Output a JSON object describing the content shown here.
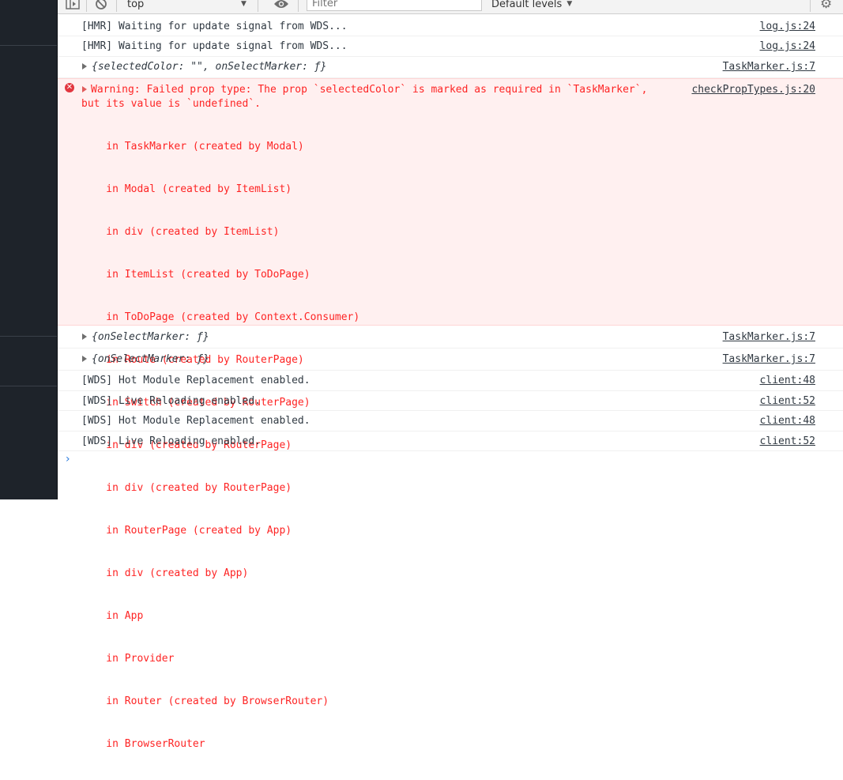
{
  "toolbar": {
    "context": "top",
    "filter_placeholder": "Filter",
    "levels": "Default levels"
  },
  "logs_top": [
    {
      "msg": "[HMR] Waiting for update signal from WDS...",
      "src": "log.js:24"
    },
    {
      "msg": "[HMR] Waiting for update signal from WDS...",
      "src": "log.js:24"
    },
    {
      "msg": "{selectedColor: \"\", onSelectMarker: ƒ}",
      "src": "TaskMarker.js:7"
    }
  ],
  "error": {
    "line1": "Warning: Failed prop type: The prop `selectedColor` is marked as required in `TaskMarker`,",
    "line2": "but its value is `undefined`.",
    "src": "checkPropTypes.js:20",
    "stack": [
      "    in TaskMarker (created by Modal)",
      "    in Modal (created by ItemList)",
      "    in div (created by ItemList)",
      "    in ItemList (created by ToDoPage)",
      "    in ToDoPage (created by Context.Consumer)",
      "    in Route (created by RouterPage)",
      "    in Switch (created by RouterPage)",
      "    in div (created by RouterPage)",
      "    in div (created by RouterPage)",
      "    in RouterPage (created by App)",
      "    in div (created by App)",
      "    in App",
      "    in Provider",
      "    in Router (created by BrowserRouter)",
      "    in BrowserRouter"
    ]
  },
  "logs_bottom": [
    {
      "msg": "{onSelectMarker: ƒ}",
      "src": "TaskMarker.js:7"
    },
    {
      "msg": "{onSelectMarker: ƒ}",
      "src": "TaskMarker.js:7"
    },
    {
      "msg": "[WDS] Hot Module Replacement enabled.",
      "src": "client:48"
    },
    {
      "msg": "[WDS] Live Reloading enabled.",
      "src": "client:52"
    },
    {
      "msg": "[WDS] Hot Module Replacement enabled.",
      "src": "client:48"
    },
    {
      "msg": "[WDS] Live Reloading enabled.",
      "src": "client:52"
    }
  ],
  "prompt": "›",
  "colors": {
    "error_text": "#fe2424",
    "error_bg": "#fff0f0",
    "panel_bg": "#1e232a",
    "prompt": "#2a7bde"
  }
}
